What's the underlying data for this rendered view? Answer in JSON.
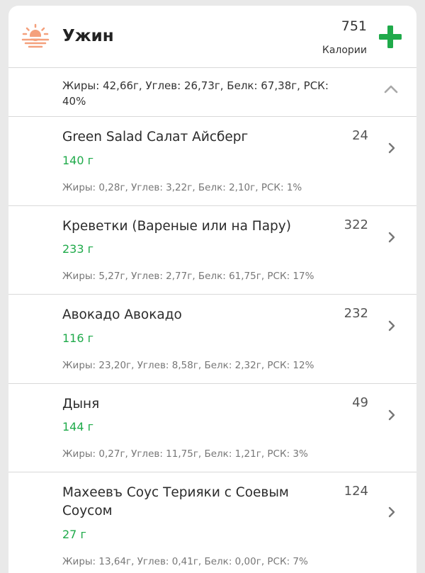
{
  "meal": {
    "title": "Ужин",
    "calories": "751",
    "calories_label": "Калории",
    "summary": "Жиры: 42,66г, Углев: 26,73г, Белк: 67,38г, РСК: 40%",
    "accent_color": "#1faa4a",
    "sun_color": "#f4a07c",
    "icons": {
      "meal": "sunset-icon",
      "add": "plus-icon",
      "collapse": "chevron-up-icon",
      "item": "chevron-right-icon"
    }
  },
  "items": [
    {
      "name": "Green Salad Салат Айсберг",
      "calories": "24",
      "weight": "140 г",
      "macros": "Жиры: 0,28г, Углев: 3,22г, Белк: 2,10г, РСК: 1%"
    },
    {
      "name": "Креветки (Вареные или на Пару)",
      "calories": "322",
      "weight": "233 г",
      "macros": "Жиры: 5,27г, Углев: 2,77г, Белк: 61,75г, РСК: 17%"
    },
    {
      "name": "Авокадо Авокадо",
      "calories": "232",
      "weight": "116 г",
      "macros": "Жиры: 23,20г, Углев: 8,58г, Белк: 2,32г, РСК: 12%"
    },
    {
      "name": "Дыня",
      "calories": "49",
      "weight": "144 г",
      "macros": "Жиры: 0,27г, Углев: 11,75г, Белк: 1,21г, РСК: 3%"
    },
    {
      "name": "Махеевъ Соус Терияки с Соевым Соусом",
      "calories": "124",
      "weight": "27 г",
      "macros": "Жиры: 13,64г, Углев: 0,41г, Белк: 0,00г, РСК: 7%"
    }
  ]
}
